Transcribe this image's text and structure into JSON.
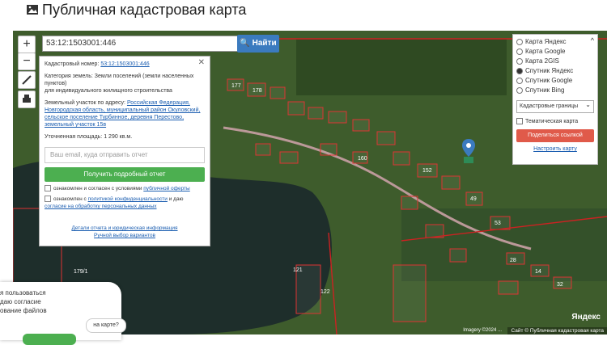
{
  "header": {
    "title": "Публичная кадастровая карта"
  },
  "search": {
    "value": "53:12:1503001:446",
    "button_label": "🔍 Найти"
  },
  "zoom": {
    "plus": "+",
    "minus": "−"
  },
  "info": {
    "close": "✕",
    "cadastral_label": "Кадастровый номер:",
    "cadastral_value": "53:12:1503001:446",
    "category_label": "Категория земель:",
    "category_value": "Земли поселений (земли населенных пунктов)",
    "use_value": "для индивидуального жилищного строительства",
    "address_label": "Земельный участок по адресу:",
    "address_value": "Российская Федерация, Новгородская область, муниципальный район Окуловский, сельское поселение Турбинное, деревня Перестово, земельный участок 15в",
    "area_label": "Уточненная площадь:",
    "area_value": "1 290 кв.м.",
    "email_placeholder": "Ваш email, куда отправить отчет",
    "report_button": "Получить подробный отчет",
    "agree1_text": "ознакомлен и согласен с условиями",
    "agree1_link": "публичной оферты",
    "agree2_text": "ознакомлен с",
    "agree2_link": "политикой конфиденциальности",
    "agree2_tail": "и даю",
    "agree2_link2": "согласие на обработку персональных данных",
    "footer_link1": "Детали отчета и юридическая информация",
    "footer_link2": "Ручной выбор вариантов"
  },
  "layers": {
    "options": [
      "Карта Яндекс",
      "Карта Google",
      "Карта 2GIS",
      "Спутник Яндекс",
      "Спутник Google",
      "Спутник Bing"
    ],
    "selected": "Спутник Яндекс",
    "collapse_icon": "^",
    "select_value": "Кадастровые границы",
    "thematic_label": "Тематическая карта",
    "share_button": "Поделиться ссылкой",
    "configure_link": "Настроить карту"
  },
  "map": {
    "yandex_logo": "Яндекс",
    "attribution": "Сайт © Публичная кадастровая карта",
    "google": "Imagery ©2024 ...",
    "parcel_labels": [
      "177",
      "178",
      "179/1",
      "160",
      "122",
      "152",
      "121",
      "49",
      "53",
      "28",
      "14",
      "32"
    ]
  },
  "cookie": {
    "line1": "я пользоваться",
    "line2": "даю согласие",
    "line3": "ование файлов"
  },
  "help": {
    "label": "на карте?"
  }
}
